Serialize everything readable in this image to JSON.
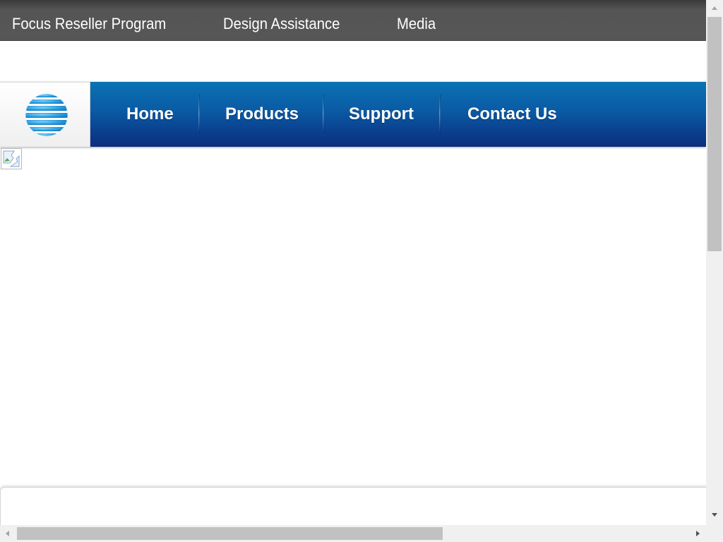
{
  "topbar": {
    "links": [
      {
        "label": "Focus Reseller Program"
      },
      {
        "label": "Design Assistance"
      },
      {
        "label": "Media"
      }
    ]
  },
  "logo": {
    "icon": "att-globe-icon",
    "colors": {
      "light": "#4fb3e8",
      "dark": "#1a8ad4"
    }
  },
  "mainnav": {
    "items": [
      {
        "label": "Home"
      },
      {
        "label": "Products"
      },
      {
        "label": "Support"
      },
      {
        "label": "Contact Us"
      }
    ],
    "colors": {
      "top": "#0a73b4",
      "bottom": "#0a2f7c"
    }
  },
  "content": {
    "broken_image_icon": "broken-image-icon"
  }
}
